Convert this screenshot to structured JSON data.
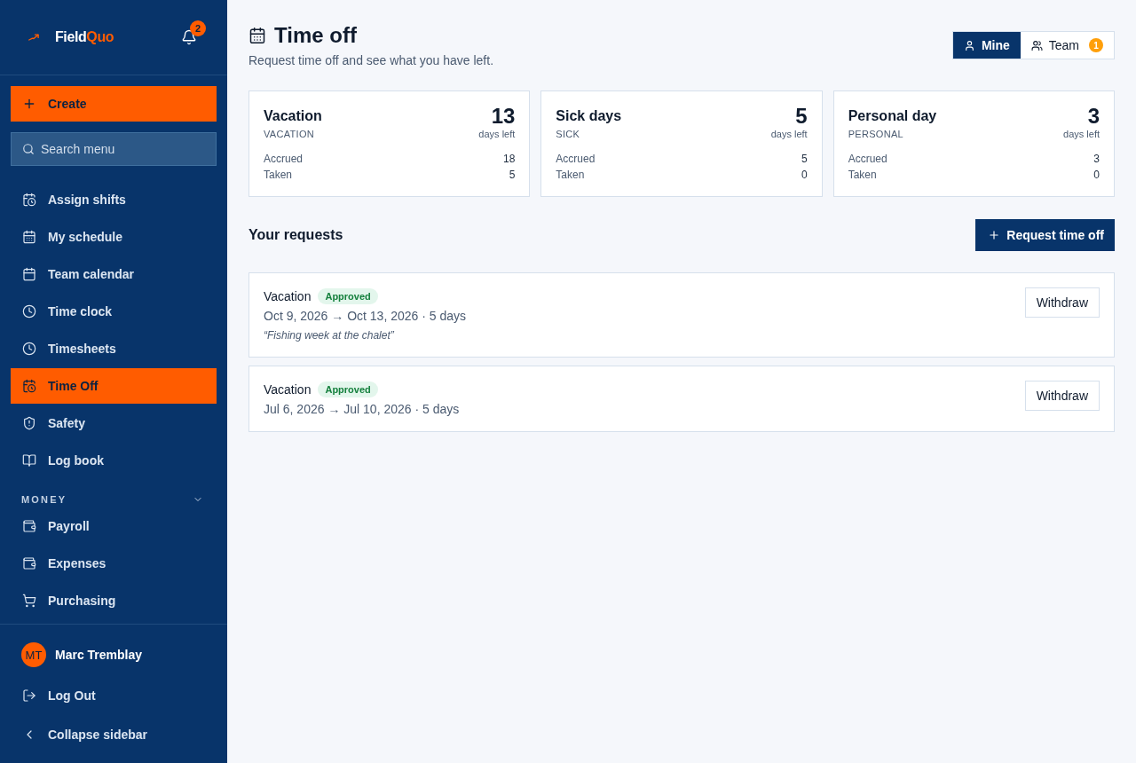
{
  "sidebar": {
    "logo": {
      "text": "Field",
      "accent": "Quo"
    },
    "notifications": "2",
    "create_button": "Create",
    "search": {
      "placeholder": "Search menu"
    },
    "sections": [
      {
        "items": [
          {
            "label": "Assign shifts",
            "selected": false
          },
          {
            "label": "My schedule",
            "selected": false
          },
          {
            "label": "Team calendar",
            "selected": false
          },
          {
            "label": "Time clock",
            "selected": false
          },
          {
            "label": "Timesheets",
            "selected": false
          },
          {
            "label": "Time Off",
            "selected": true
          },
          {
            "label": "Safety",
            "selected": false
          },
          {
            "label": "Log book",
            "selected": false
          }
        ]
      },
      {
        "title": "MONEY",
        "expanded": true,
        "items": [
          {
            "label": "Payroll",
            "selected": false
          },
          {
            "label": "Expenses",
            "selected": false
          },
          {
            "label": "Purchasing",
            "selected": false
          }
        ]
      }
    ],
    "user": {
      "initials": "MT",
      "name": "Marc Tremblay"
    },
    "footer_actions": [
      {
        "label": "Log Out"
      },
      {
        "label": "Collapse sidebar"
      }
    ]
  },
  "page": {
    "title": "Time off",
    "subtitle": "Request time off and see what you have left.",
    "view_tabs": [
      {
        "label": "Mine",
        "selected": true
      },
      {
        "label": "Team",
        "selected": false,
        "badge": "1"
      }
    ]
  },
  "balances": [
    {
      "name": "Vacation",
      "code": "VACATION",
      "remaining": "13",
      "remaining_label": "days left",
      "rows": [
        {
          "label": "Accrued",
          "value": "18"
        },
        {
          "label": "Taken",
          "value": "5"
        }
      ]
    },
    {
      "name": "Sick days",
      "code": "SICK",
      "remaining": "5",
      "remaining_label": "days left",
      "rows": [
        {
          "label": "Accrued",
          "value": "5"
        },
        {
          "label": "Taken",
          "value": "0"
        }
      ]
    },
    {
      "name": "Personal day",
      "code": "PERSONAL",
      "remaining": "3",
      "remaining_label": "days left",
      "rows": [
        {
          "label": "Accrued",
          "value": "3"
        },
        {
          "label": "Taken",
          "value": "0"
        }
      ]
    }
  ],
  "requests": {
    "title": "Your requests",
    "button": "Request time off",
    "items": [
      {
        "type": "Vacation",
        "status": "Approved",
        "dates": "Oct 9, 2026 → Oct 13, 2026 · 5 days",
        "note": "“Fishing week at the chalet”",
        "action": "Withdraw"
      },
      {
        "type": "Vacation",
        "status": "Approved",
        "dates": "Jul 6, 2026 → Jul 10, 2026 · 5 days",
        "action": "Withdraw"
      }
    ]
  }
}
